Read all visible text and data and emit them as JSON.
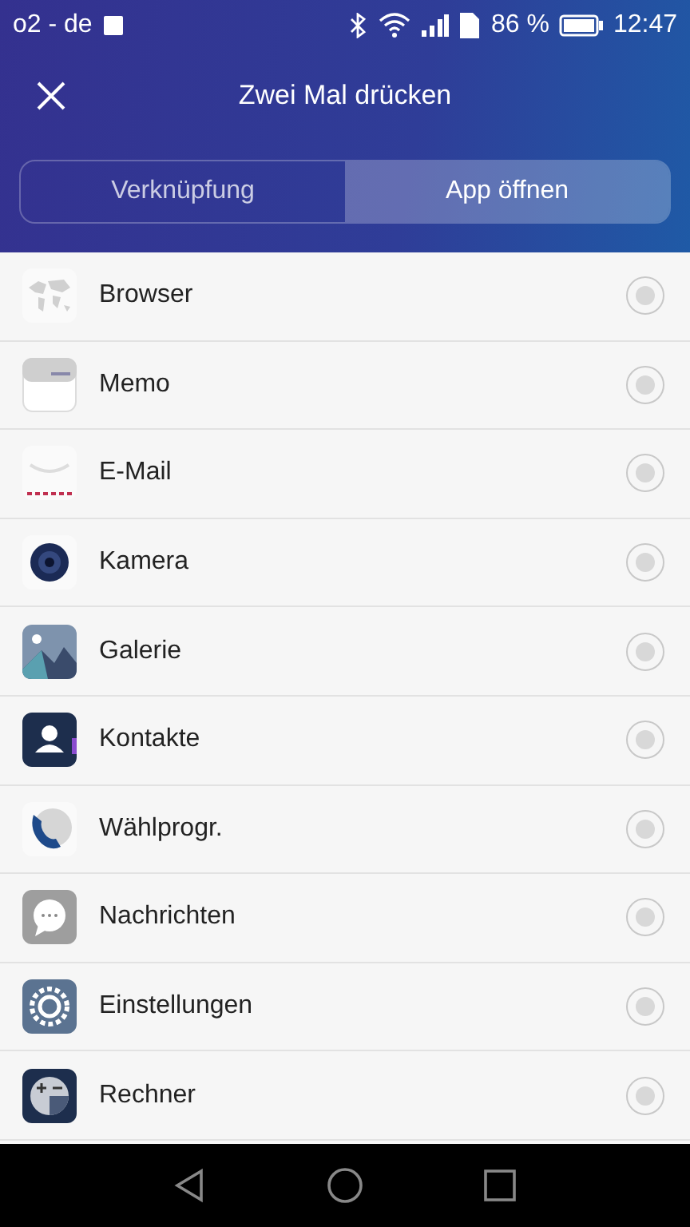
{
  "status_bar": {
    "carrier": "o2 - de",
    "battery_text": "86 %",
    "time": "12:47"
  },
  "header": {
    "title": "Zwei Mal drücken"
  },
  "tabs": [
    {
      "label": "Verknüpfung",
      "selected": false
    },
    {
      "label": "App öffnen",
      "selected": true
    }
  ],
  "apps": [
    {
      "kind": "browser",
      "name": "Browser",
      "selected": false
    },
    {
      "kind": "memo",
      "name": "Memo",
      "selected": false
    },
    {
      "kind": "mail",
      "name": "E-Mail",
      "selected": false
    },
    {
      "kind": "camera",
      "name": "Kamera",
      "selected": false
    },
    {
      "kind": "gallery",
      "name": "Galerie",
      "selected": false
    },
    {
      "kind": "contacts",
      "name": "Kontakte",
      "selected": false
    },
    {
      "kind": "dialer",
      "name": "Wählprogr.",
      "selected": false
    },
    {
      "kind": "messages",
      "name": "Nachrichten",
      "selected": false
    },
    {
      "kind": "settings",
      "name": "Einstellungen",
      "selected": false
    },
    {
      "kind": "calculator",
      "name": "Rechner",
      "selected": false
    }
  ]
}
